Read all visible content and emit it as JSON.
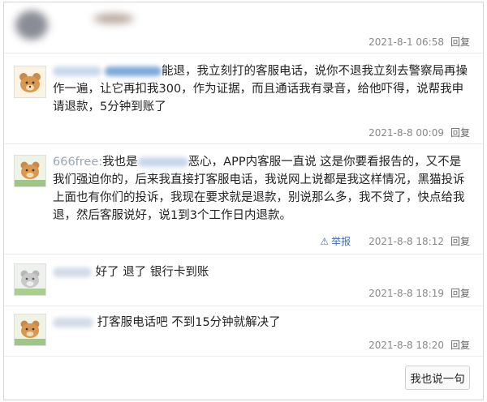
{
  "comments": [
    {
      "username": "",
      "text": "",
      "date": "2021-8-1 06:58",
      "reply_label": "回复",
      "has_report": false
    },
    {
      "username": "",
      "text": "能退，我立刻打的客服电话，说你不退我立刻去警察局再操作一遍，让它再扣我300，作为证据，而且通话我有录音，给他吓得，说帮我申请退款，5分钟到账了",
      "date": "2021-8-8 00:09",
      "reply_label": "回复",
      "has_report": false
    },
    {
      "username": "666free:",
      "text": "我也是",
      "text2": "恶心，APP内客服一直说 这是你要看报告的，又不是我们强迫你的，后来我直接打客服电话，我说网上说都是我这样情况，黑猫投诉上面也有你们的投诉，我现在要求就是退款，别说那么多，我不贷了，快点给我退，然后客服说好，说1到3个工作日内退款。",
      "date": "2021-8-8 18:12",
      "reply_label": "回复",
      "report_label": "举报",
      "has_report": true
    },
    {
      "username": "",
      "text": "好了 退了 银行卡到账",
      "date": "2021-8-8 18:19",
      "reply_label": "回复",
      "has_report": false
    },
    {
      "username": "",
      "text": "打客服电话吧 不到15分钟就解决了",
      "date": "2021-8-8 18:20",
      "reply_label": "回复",
      "has_report": false
    }
  ],
  "post_button_label": "我也说一句",
  "colors": {
    "username": "#9aa5b5",
    "meta": "#888888",
    "report": "#3f6bb8",
    "border": "#d8d8d8"
  }
}
